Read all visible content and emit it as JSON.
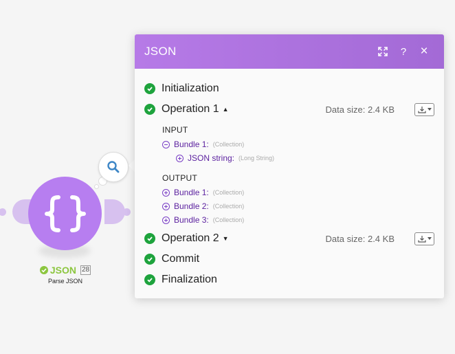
{
  "module": {
    "title": "JSON",
    "operations_count": "28",
    "subtitle": "Parse JSON"
  },
  "panel": {
    "title": "JSON",
    "header_icons": [
      "expand-icon",
      "help-icon",
      "close-icon"
    ],
    "help_label": "?",
    "close_label": "×",
    "stages": {
      "initialization": "Initialization",
      "operation1": "Operation 1",
      "operation2": "Operation 2",
      "commit": "Commit",
      "finalization": "Finalization"
    },
    "data_size": "Data size: 2.4 KB",
    "input": {
      "heading": "INPUT",
      "bundle": {
        "name": "Bundle 1:",
        "type": "(Collection)"
      },
      "child": {
        "name": "JSON string:",
        "type": "(Long String)"
      }
    },
    "output": {
      "heading": "OUTPUT",
      "bundles": [
        {
          "name": "Bundle 1:",
          "type": "(Collection)"
        },
        {
          "name": "Bundle 2:",
          "type": "(Collection)"
        },
        {
          "name": "Bundle 3:",
          "type": "(Collection)"
        }
      ]
    }
  },
  "colors": {
    "header": "#b67ae7",
    "node": "#b77ef0",
    "success": "#1ea33d",
    "bundle_text": "#5a1f9e",
    "module_label": "#8cc63f"
  }
}
